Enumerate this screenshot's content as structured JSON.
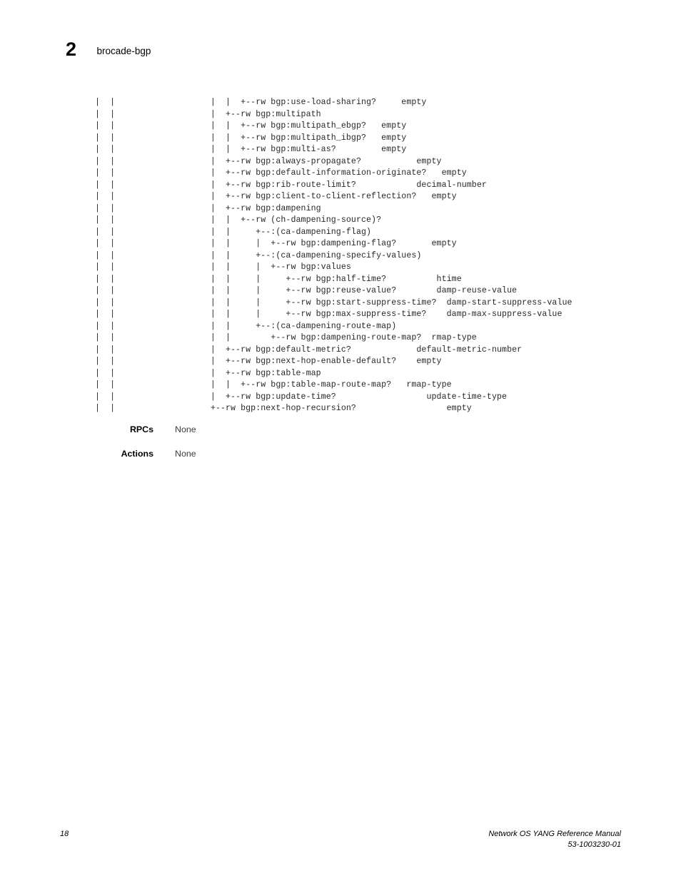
{
  "page": {
    "chapter_number": "2",
    "chapter_title": "brocade-bgp",
    "page_number": "18",
    "manual_title": "Network OS YANG Reference Manual",
    "document_id": "53-1003230-01",
    "colors": {
      "text": "#000000",
      "code_text": "#25282a",
      "definition_text": "#3c3c3c",
      "background": "#ffffff"
    }
  },
  "yang_tree": {
    "lines": [
      "|  |                   |  |  +--rw bgp:use-load-sharing?     empty",
      "|  |                   |  +--rw bgp:multipath",
      "|  |                   |  |  +--rw bgp:multipath_ebgp?   empty",
      "|  |                   |  |  +--rw bgp:multipath_ibgp?   empty",
      "|  |                   |  |  +--rw bgp:multi-as?         empty",
      "|  |                   |  +--rw bgp:always-propagate?           empty",
      "|  |                   |  +--rw bgp:default-information-originate?   empty",
      "|  |                   |  +--rw bgp:rib-route-limit?            decimal-number",
      "|  |                   |  +--rw bgp:client-to-client-reflection?   empty",
      "|  |                   |  +--rw bgp:dampening",
      "|  |                   |  |  +--rw (ch-dampening-source)?",
      "|  |                   |  |     +--:(ca-dampening-flag)",
      "|  |                   |  |     |  +--rw bgp:dampening-flag?       empty",
      "|  |                   |  |     +--:(ca-dampening-specify-values)",
      "|  |                   |  |     |  +--rw bgp:values",
      "|  |                   |  |     |     +--rw bgp:half-time?          htime",
      "|  |                   |  |     |     +--rw bgp:reuse-value?        damp-reuse-value",
      "|  |                   |  |     |     +--rw bgp:start-suppress-time?  damp-start-suppress-value",
      "|  |                   |  |     |     +--rw bgp:max-suppress-time?    damp-max-suppress-value",
      "|  |                   |  |     +--:(ca-dampening-route-map)",
      "|  |                   |  |        +--rw bgp:dampening-route-map?  rmap-type",
      "|  |                   |  +--rw bgp:default-metric?             default-metric-number",
      "|  |                   |  +--rw bgp:next-hop-enable-default?    empty",
      "|  |                   |  +--rw bgp:table-map",
      "|  |                   |  |  +--rw bgp:table-map-route-map?   rmap-type",
      "|  |                   |  +--rw bgp:update-time?                  update-time-type",
      "|  |                   +--rw bgp:next-hop-recursion?                  empty"
    ]
  },
  "definitions": [
    {
      "term": "RPCs",
      "value": "None"
    },
    {
      "term": "Actions",
      "value": "None"
    }
  ]
}
